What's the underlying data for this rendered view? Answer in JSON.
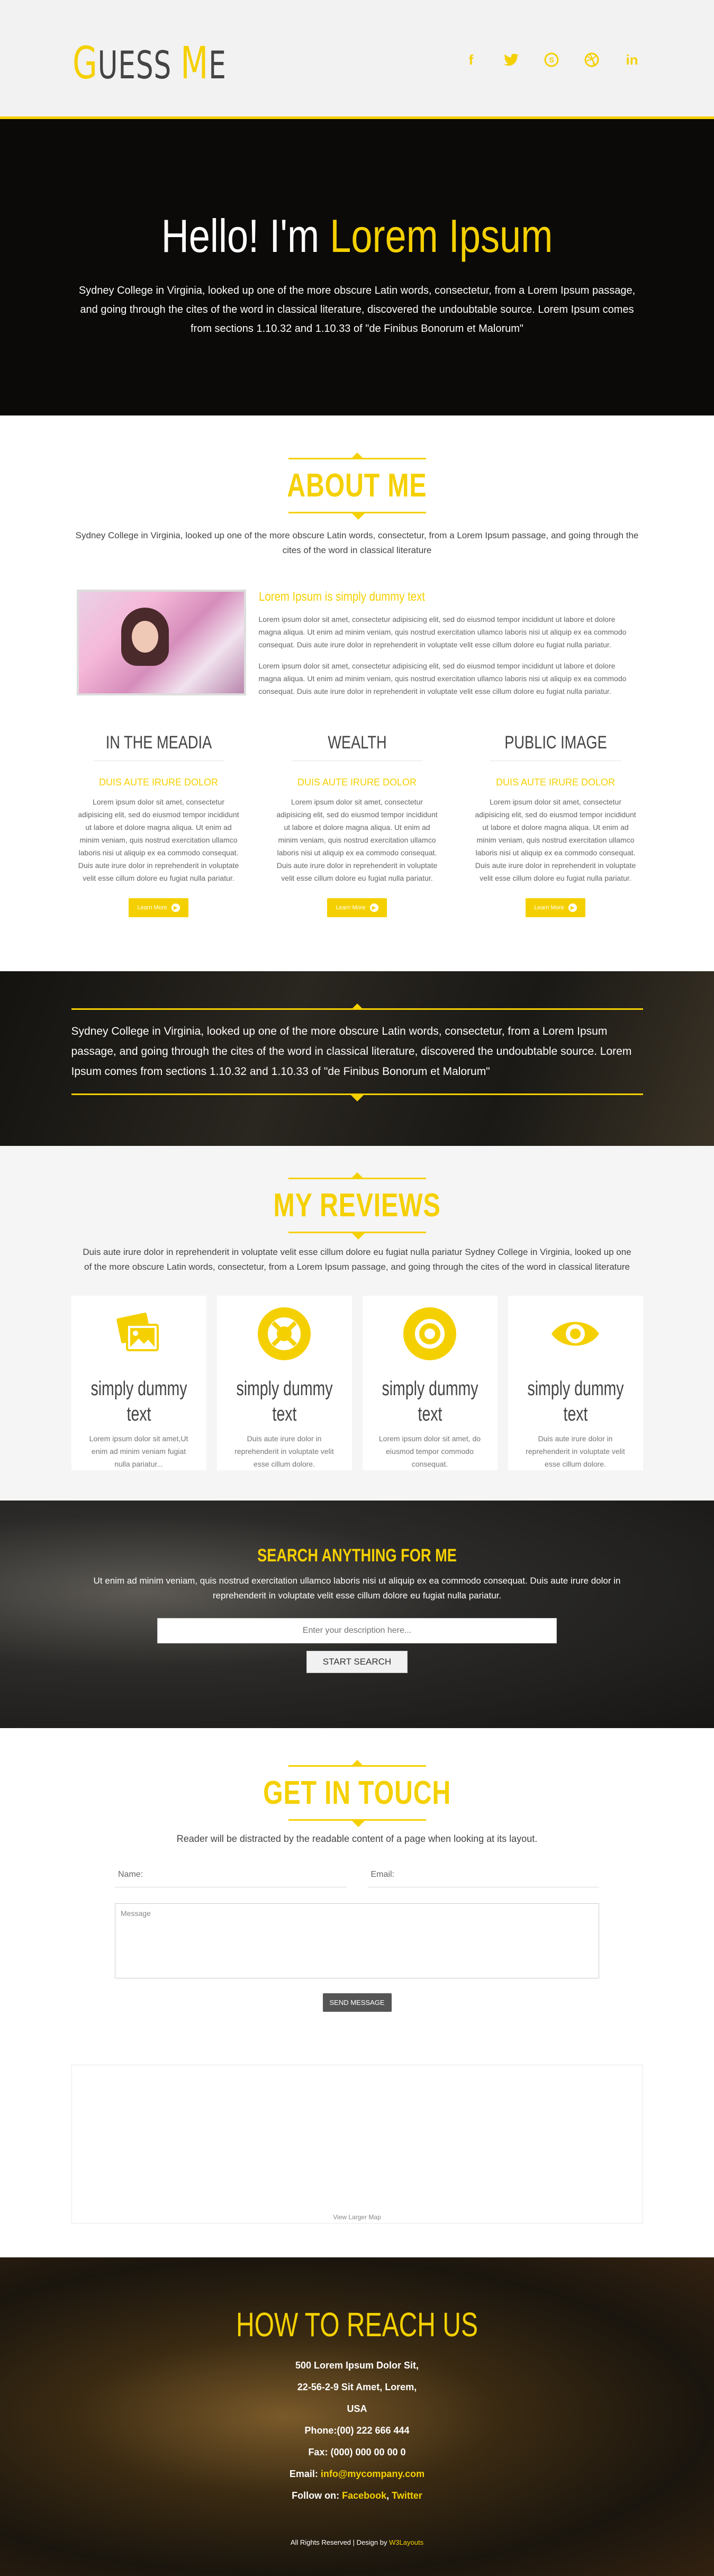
{
  "header": {
    "logo_g": "G",
    "logo_uess": "UESS ",
    "logo_m": "M",
    "logo_e": "E",
    "social": [
      {
        "name": "facebook-icon",
        "glyph": "f"
      },
      {
        "name": "twitter-icon",
        "glyph": "t"
      },
      {
        "name": "skype-icon",
        "glyph": "S"
      },
      {
        "name": "dribbble-icon",
        "glyph": "◎"
      },
      {
        "name": "linkedin-icon",
        "glyph": "in"
      }
    ]
  },
  "hero": {
    "title_prefix": "Hello! I'm ",
    "title_name": "Lorem Ipsum",
    "text": "Sydney College in Virginia, looked up one of the more obscure Latin words, consectetur, from a Lorem Ipsum passage, and going through the cites of the word in classical literature, discovered the undoubtable source. Lorem Ipsum comes from sections 1.10.32 and 1.10.33 of \"de Finibus Bonorum et Malorum\""
  },
  "about": {
    "title": "ABOUT ME",
    "intro": "Sydney College in Virginia, looked up one of the more obscure Latin words, consectetur, from a Lorem Ipsum passage, and going through the cites of the word in classical literature",
    "profile_heading": "Lorem Ipsum is simply dummy text",
    "profile_p1": "Lorem ipsum dolor sit amet, consectetur adipisicing elit, sed do eiusmod tempor incididunt ut labore et dolore magna aliqua. Ut enim ad minim veniam, quis nostrud exercitation ullamco laboris nisi ut aliquip ex ea commodo consequat. Duis aute irure dolor in reprehenderit in voluptate velit esse cillum dolore eu fugiat nulla pariatur.",
    "profile_p2": "Lorem ipsum dolor sit amet, consectetur adipisicing elit, sed do eiusmod tempor incididunt ut labore et dolore magna aliqua. Ut enim ad minim veniam, quis nostrud exercitation ullamco laboris nisi ut aliquip ex ea commodo consequat. Duis aute irure dolor in reprehenderit in voluptate velit esse cillum dolore eu fugiat nulla pariatur.",
    "columns": [
      {
        "title": "IN THE MEADIA",
        "subtitle": "DUIS AUTE IRURE DOLOR",
        "text": "Lorem ipsum dolor sit amet, consectetur adipisicing elit, sed do eiusmod tempor incididunt ut labore et dolore magna aliqua. Ut enim ad minim veniam, quis nostrud exercitation ullamco laboris nisi ut aliquip ex ea commodo consequat. Duis aute irure dolor in reprehenderit in voluptate velit esse cillum dolore eu fugiat nulla pariatur.",
        "button": "Learn More"
      },
      {
        "title": "WEALTH",
        "subtitle": "DUIS AUTE IRURE DOLOR",
        "text": "Lorem ipsum dolor sit amet, consectetur adipisicing elit, sed do eiusmod tempor incididunt ut labore et dolore magna aliqua. Ut enim ad minim veniam, quis nostrud exercitation ullamco laboris nisi ut aliquip ex ea commodo consequat. Duis aute irure dolor in reprehenderit in voluptate velit esse cillum dolore eu fugiat nulla pariatur.",
        "button": "Learn More"
      },
      {
        "title": "PUBLIC IMAGE",
        "subtitle": "DUIS AUTE IRURE DOLOR",
        "text": "Lorem ipsum dolor sit amet, consectetur adipisicing elit, sed do eiusmod tempor incididunt ut labore et dolore magna aliqua. Ut enim ad minim veniam, quis nostrud exercitation ullamco laboris nisi ut aliquip ex ea commodo consequat. Duis aute irure dolor in reprehenderit in voluptate velit esse cillum dolore eu fugiat nulla pariatur.",
        "button": "Learn More"
      }
    ]
  },
  "quote": {
    "text": "Sydney College in Virginia, looked up one of the more obscure Latin words, consectetur, from a Lorem Ipsum passage, and going through the cites of the word in classical literature, discovered the undoubtable source. Lorem Ipsum comes from sections 1.10.32 and 1.10.33 of \"de Finibus Bonorum et Malorum\""
  },
  "reviews": {
    "title": "MY REVIEWS",
    "intro": "Duis aute irure dolor in reprehenderit in voluptate velit esse cillum dolore eu fugiat nulla pariatur Sydney College in Virginia, looked up one of the more obscure Latin words, consectetur, from a Lorem Ipsum passage, and going through the cites of the word in classical literature",
    "cards": [
      {
        "icon": "photos-icon",
        "title": "simply dummy text",
        "text": "Lorem ipsum dolor sit amet,Ut enim ad minim veniam fugiat nulla pariatur..."
      },
      {
        "icon": "lifebuoy-icon",
        "title": "simply dummy text",
        "text": "Duis aute irure dolor in reprehenderit in voluptate velit esse cillum dolore."
      },
      {
        "icon": "target-icon",
        "title": "simply dummy text",
        "text": "Lorem ipsum dolor sit amet, do eiusmod tempor commodo consequat."
      },
      {
        "icon": "eye-icon",
        "title": "simply dummy text",
        "text": "Duis aute irure dolor in reprehenderit in voluptate velit esse cillum dolore."
      }
    ]
  },
  "search": {
    "title": "SEARCH ANYTHING FOR ME",
    "text": "Ut enim ad minim veniam, quis nostrud exercitation ullamco laboris nisi ut aliquip ex ea commodo consequat. Duis aute irure dolor in reprehenderit in voluptate velit esse cillum dolore eu fugiat nulla pariatur.",
    "placeholder": "Enter your description here...",
    "button": "START SEARCH"
  },
  "contact": {
    "title": "GET IN TOUCH",
    "intro": "Reader will be distracted by the readable content of a page when looking at its layout.",
    "name_placeholder": "Name:",
    "email_placeholder": "Email:",
    "message_placeholder": "Message",
    "send_button": "SEND MESSAGE",
    "map_link": "View Larger Map"
  },
  "footer": {
    "title": "HOW TO REACH US",
    "address_1": "500 Lorem Ipsum Dolor Sit,",
    "address_2": "22-56-2-9 Sit Amet, Lorem,",
    "address_3": "USA",
    "phone": "Phone:(00) 222 666 444",
    "fax": "Fax: (000) 000 00 00 0",
    "email_label": "Email: ",
    "email": "info@mycompany.com",
    "follow_label": "Follow on: ",
    "follow_facebook": "Facebook",
    "follow_sep": ", ",
    "follow_twitter": "Twitter",
    "copyright": "All Rights Reserved | Design by ",
    "designer": "W3Layouts"
  },
  "colors": {
    "accent": "#f5d000",
    "dark": "#0b0a09"
  }
}
